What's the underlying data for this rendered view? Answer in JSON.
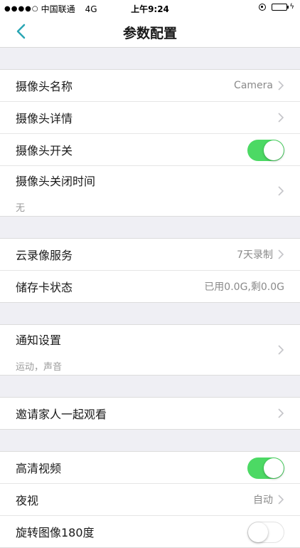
{
  "status_bar": {
    "signal": "●●●●○",
    "carrier": "中国联通",
    "network": "4G",
    "time": "上午9:24",
    "icons": [
      "rotation-lock-icon",
      "battery-icon",
      "charging-icon"
    ],
    "battery_level": 0.7
  },
  "nav": {
    "title": "参数配置",
    "back_icon": "chevron-left-icon"
  },
  "colors": {
    "accent": "#2aa6b4",
    "toggle_on": "#4cd964",
    "background": "#efeff4"
  },
  "groups": [
    {
      "rows": [
        {
          "label": "摄像头名称",
          "value": "Camera"
        },
        {
          "label": "摄像头详情",
          "value": ""
        },
        {
          "label": "摄像头开关",
          "toggle": true
        },
        {
          "label": "摄像头关闭时间",
          "sub": "无"
        }
      ]
    },
    {
      "rows": [
        {
          "label": "云录像服务",
          "value": "7天录制"
        },
        {
          "label": "储存卡状态",
          "value": "已用0.0G,剩0.0G"
        }
      ]
    },
    {
      "rows": [
        {
          "label": "通知设置",
          "sub": "运动，声音"
        }
      ]
    },
    {
      "rows": [
        {
          "label": "邀请家人一起观看",
          "value": ""
        }
      ]
    },
    {
      "rows": [
        {
          "label": "高清视频",
          "toggle": true
        },
        {
          "label": "夜视",
          "value": "自动"
        },
        {
          "label": "旋转图像180度",
          "toggle": false
        }
      ]
    }
  ]
}
